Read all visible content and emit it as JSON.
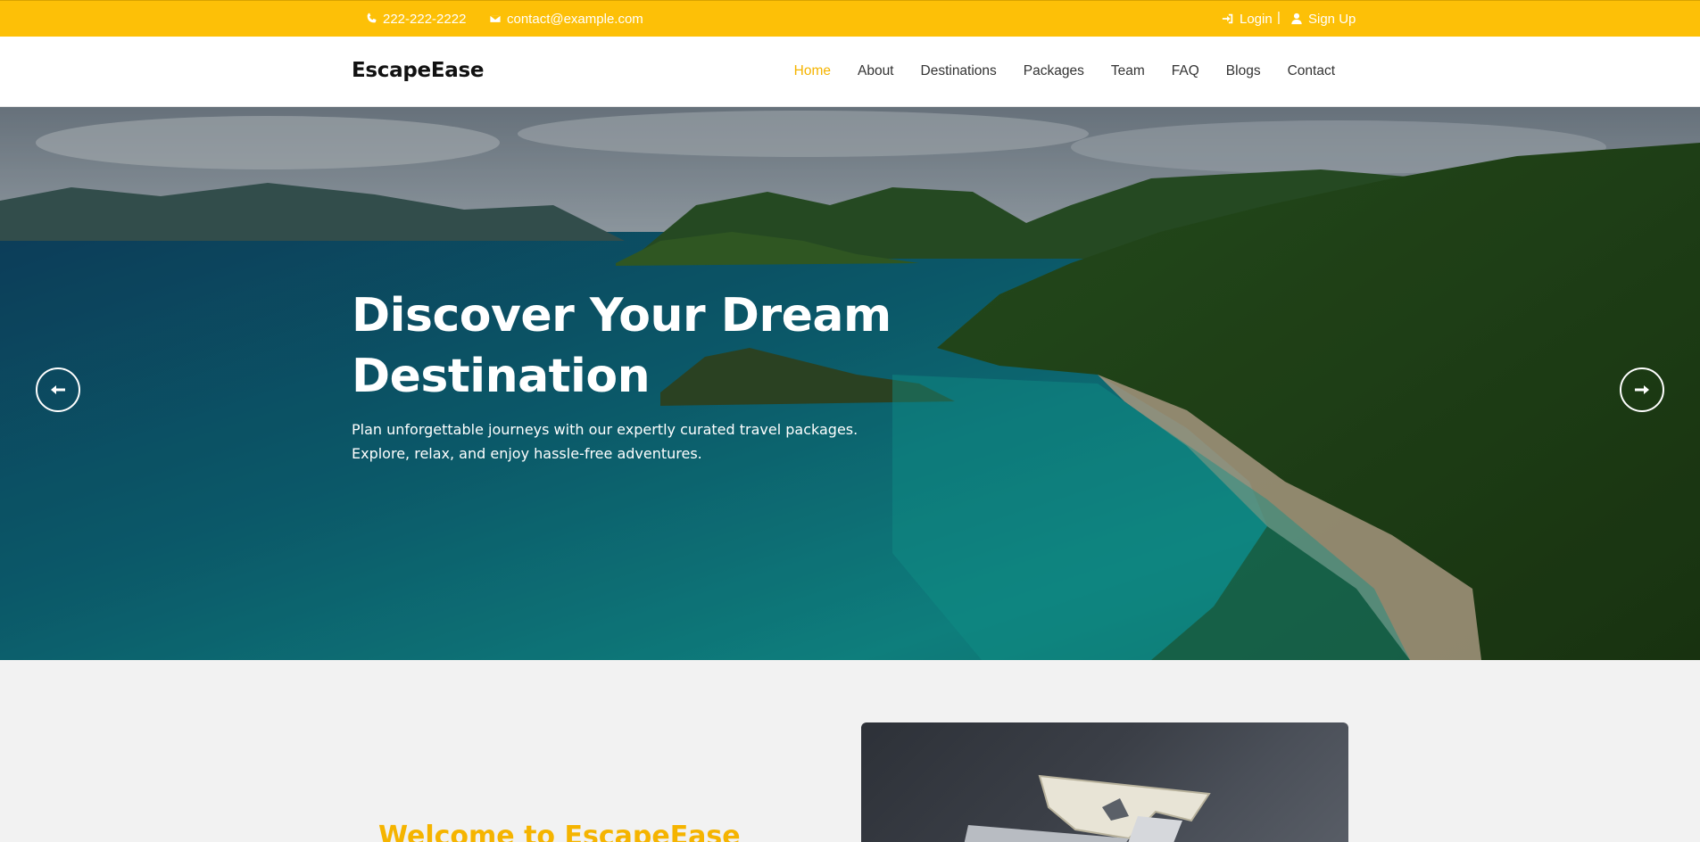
{
  "topbar": {
    "phone": "222-222-2222",
    "email": "contact@example.com",
    "login": "Login",
    "separator": "|",
    "signup": "Sign Up",
    "bg_color": "#fdc007"
  },
  "nav": {
    "brand": "EscapeEase",
    "items": [
      {
        "label": "Home",
        "active": true
      },
      {
        "label": "About"
      },
      {
        "label": "Destinations"
      },
      {
        "label": "Packages"
      },
      {
        "label": "Team"
      },
      {
        "label": "FAQ"
      },
      {
        "label": "Blogs"
      },
      {
        "label": "Contact"
      }
    ],
    "active_color": "#f5b400"
  },
  "hero": {
    "title": "Discover Your Dream Destination",
    "subtitle": "Plan unforgettable journeys with our expertly curated travel packages. Explore, relax, and enjoy hassle-free adventures.",
    "prev_icon": "arrow-left-icon",
    "next_icon": "arrow-right-icon"
  },
  "welcome": {
    "title": "Welcome to EscapeEase",
    "title_color": "#f5b400"
  }
}
